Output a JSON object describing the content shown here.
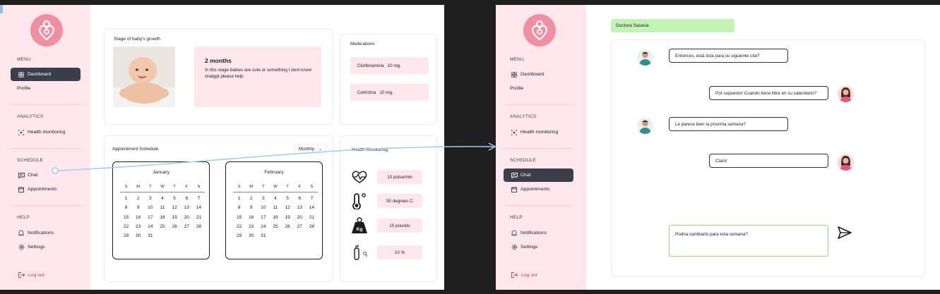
{
  "sidebar": {
    "menu_label": "MENU",
    "dashboard_label": "Dashboard",
    "profile_label": "Profile",
    "analytics_label": "ANALYTICS",
    "health_monitoring_label": "Health monitoring",
    "schedule_label": "SCHEDULE",
    "chat_label": "Chat",
    "appointments_label": "Appointments",
    "help_label": "HELP",
    "notifications_label": "Notifications",
    "settings_label": "Settings",
    "logout_label": "Log out"
  },
  "growth": {
    "title": "Stage of baby's growth",
    "heading": "2 months",
    "text": "In this stage babies are cute or something I dont know chatgpt please help"
  },
  "medications": {
    "title": "Medications",
    "items": [
      {
        "name": "Clorfenamina",
        "dose": "10 mg."
      },
      {
        "name": "Cetirizina",
        "dose": "10 mg."
      }
    ]
  },
  "appointments": {
    "title": "Appointment Schedule",
    "range_selector": "Monthly",
    "weekdays": [
      "S",
      "M",
      "T",
      "W",
      "T",
      "F",
      "S"
    ],
    "calendars": [
      {
        "month": "January",
        "days": [
          1,
          2,
          3,
          4,
          5,
          6,
          7,
          8,
          9,
          10,
          11,
          12,
          13,
          14,
          15,
          16,
          17,
          18,
          19,
          20,
          21,
          22,
          23,
          24,
          25,
          26,
          27,
          28,
          29,
          30,
          31
        ]
      },
      {
        "month": "February",
        "days": [
          1,
          2,
          3,
          4,
          5,
          6,
          7,
          8,
          9,
          10,
          11,
          12,
          13,
          14,
          15,
          16,
          17,
          18,
          19,
          20,
          21,
          22,
          23,
          24,
          25,
          26,
          27,
          28,
          29,
          30,
          31
        ]
      }
    ]
  },
  "health": {
    "title": "Health Monitoring",
    "items": [
      {
        "icon": "heart-pulse-icon",
        "value": "10 pulse/min"
      },
      {
        "icon": "thermometer-icon",
        "value": "50 degrees C"
      },
      {
        "icon": "weight-icon",
        "value": "10 pounds",
        "icon_text": "Kg"
      },
      {
        "icon": "oxygen-tank-icon",
        "value": "10 %"
      }
    ]
  },
  "chat": {
    "contact": "Doctora Saravia",
    "messages": [
      {
        "from": "doctor",
        "text": "Entonces, está lista para su siguiente cita?"
      },
      {
        "from": "patient",
        "text": "Por supuesto! Cuando tiene libre en su calendario?"
      },
      {
        "from": "doctor",
        "text": "Le parece bien la proxima semana?"
      },
      {
        "from": "patient",
        "text": "Claro!"
      }
    ],
    "draft": "Podria cambiarlo para esta semana?"
  },
  "colors": {
    "sidebar_bg": "#fde6ec",
    "logo_pink": "#f08fa2",
    "active_nav": "#3a3f4a",
    "logout_red": "#d23a5a",
    "doctor_tag": "#c3f3b4",
    "connector": "#9fcdf0"
  }
}
